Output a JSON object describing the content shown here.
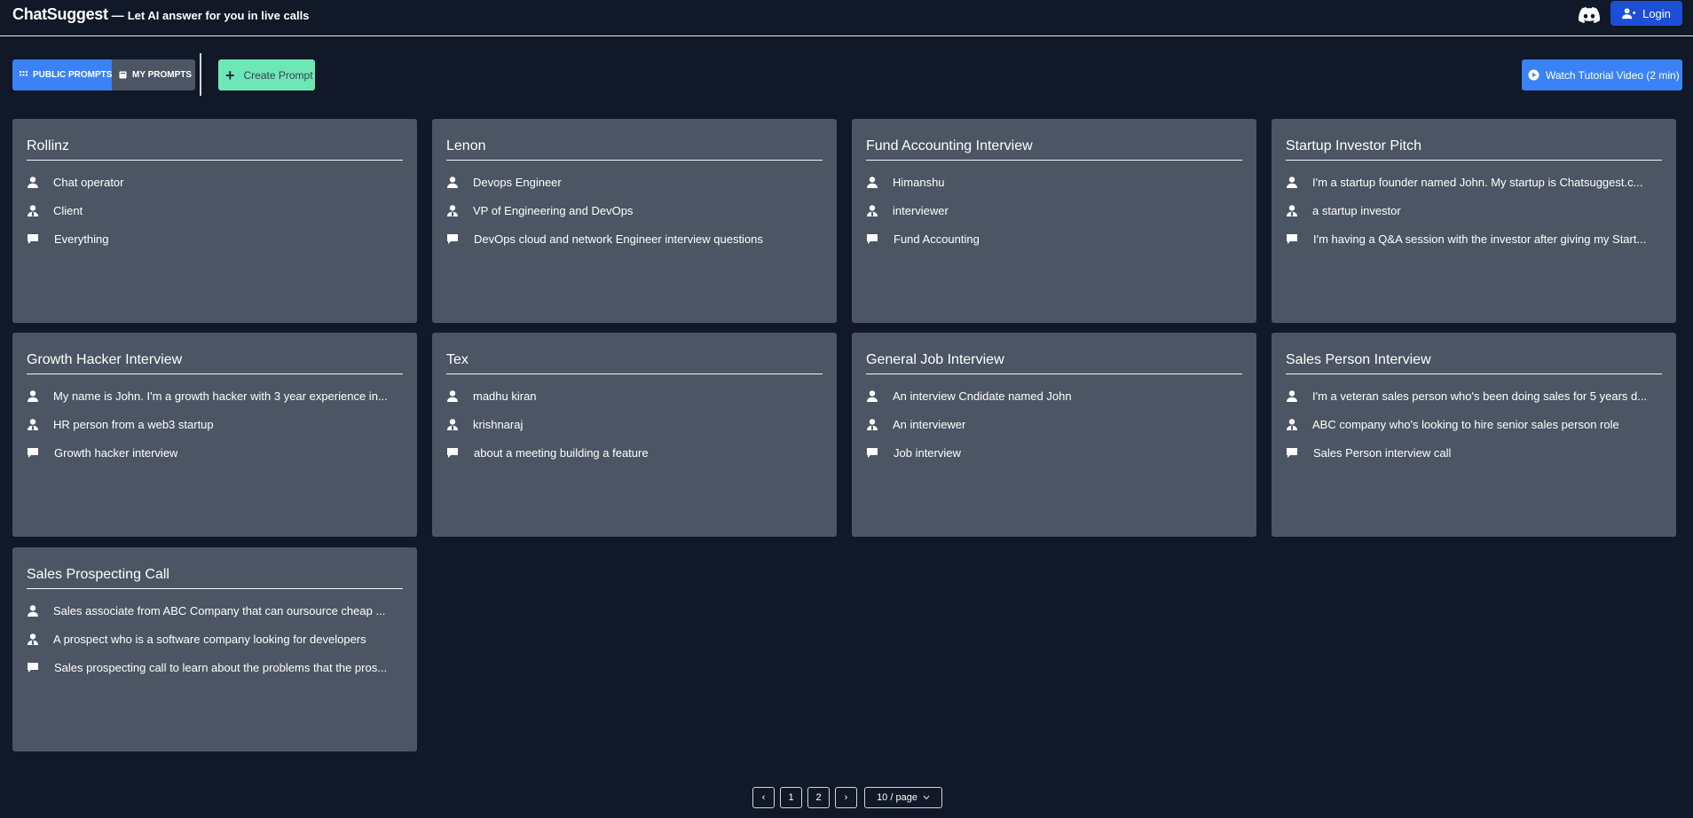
{
  "header": {
    "brand": "ChatSuggest",
    "dash": "—",
    "tagline": "Let AI answer for you in live calls",
    "login_label": "Login"
  },
  "toolbar": {
    "public_label": "PUBLIC PROMPTS",
    "my_label": "MY PROMPTS",
    "create_label": "Create Prompt",
    "tutorial_label": "Watch Tutorial Video (2 min)"
  },
  "cards": [
    {
      "title": "Rollinz",
      "me": "Chat operator",
      "them": "Client",
      "topic": "Everything"
    },
    {
      "title": "Lenon",
      "me": "Devops Engineer",
      "them": "VP of Engineering and DevOps",
      "topic": "DevOps cloud and network Engineer interview questions"
    },
    {
      "title": "Fund Accounting Interview",
      "me": "Himanshu",
      "them": "interviewer",
      "topic": "Fund Accounting"
    },
    {
      "title": "Startup Investor Pitch",
      "me": "I'm a startup founder named John. My startup is Chatsuggest.c...",
      "them": "a startup investor",
      "topic": "I'm having a Q&A session with the investor after giving my Start..."
    },
    {
      "title": "Growth Hacker Interview",
      "me": "My name is John. I'm a growth hacker with 3 year experience in...",
      "them": "HR person from a web3 startup",
      "topic": "Growth hacker interview"
    },
    {
      "title": "Tex",
      "me": "madhu kiran",
      "them": "krishnaraj",
      "topic": "about a meeting building a feature"
    },
    {
      "title": "General Job Interview",
      "me": "An interview Cndidate named John",
      "them": "An interviewer",
      "topic": "Job interview"
    },
    {
      "title": "Sales Person Interview",
      "me": "I'm a veteran sales person who's been doing sales for 5 years d...",
      "them": "ABC company who's looking to hire senior sales person role",
      "topic": "Sales Person interview call"
    },
    {
      "title": "Sales Prospecting Call",
      "me": "Sales associate from ABC Company that can oursource cheap ...",
      "them": "A prospect who is a software company looking for developers",
      "topic": "Sales prospecting call to learn about the problems that the pros..."
    }
  ],
  "pagination": {
    "prev": "‹",
    "next": "›",
    "pages": [
      "1",
      "2"
    ],
    "page_size": "10 / page"
  },
  "icons": {
    "discord": "discord-icon",
    "login": "user-add-icon",
    "public": "grid-icon",
    "my": "book-icon",
    "create": "plus-icon",
    "tutorial": "play-circle-icon",
    "me": "user-icon",
    "them": "user-tie-icon",
    "topic": "comment-icon"
  },
  "colors": {
    "background": "#111827",
    "card": "#4b5563",
    "primary": "#3b82f6",
    "login": "#1d4ed8",
    "create": "#6ee7b7"
  }
}
